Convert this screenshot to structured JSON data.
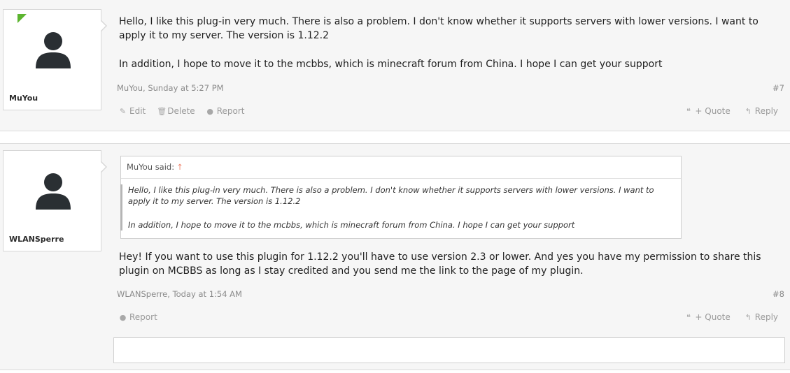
{
  "posts": [
    {
      "username": "MuYou",
      "message": [
        "Hello, I like this plug-in very much. There is also a problem. I don't know whether it supports servers with lower versions. I want to apply it to my server. The version is 1.12.2",
        "In addition, I hope to move it to the mcbbs, which is minecraft forum from China. I hope I can get your support"
      ],
      "meta": "MuYou, Sunday at 5:27 PM",
      "number": "#7",
      "actions": {
        "edit": "Edit",
        "delete": "Delete",
        "report": "Report",
        "quote": "+ Quote",
        "reply": "Reply"
      }
    },
    {
      "username": "WLANSperre",
      "quote": {
        "author": "MuYou said:",
        "text": [
          "Hello, I like this plug-in very much. There is also a problem. I don't know whether it supports servers with lower versions. I want to apply it to my server. The version is 1.12.2",
          "In addition, I hope to move it to the mcbbs, which is minecraft forum from China. I hope I can get your support"
        ]
      },
      "message": "Hey! If you want to use this plugin for 1.12.2 you'll have to use version 2.3 or lower. And yes you have my permission to share this plugin on MCBBS as long as I stay credited and you send me the link to the page of my plugin.",
      "meta": "WLANSperre, Today at 1:54 AM",
      "number": "#8",
      "actions": {
        "report": "Report",
        "quote": "+ Quote",
        "reply": "Reply"
      }
    }
  ],
  "icons": {
    "edit": "pencil-icon",
    "delete": "trash-icon",
    "report": "exclamation-circle-icon",
    "quote": "quote-icon",
    "reply": "reply-arrow-icon",
    "avatar": "default-user-avatar",
    "online": "online-indicator"
  },
  "colors": {
    "online_badge": "#5cb52f",
    "quote_up_arrow": "#f08a73",
    "post_background": "#f6f6f6"
  }
}
